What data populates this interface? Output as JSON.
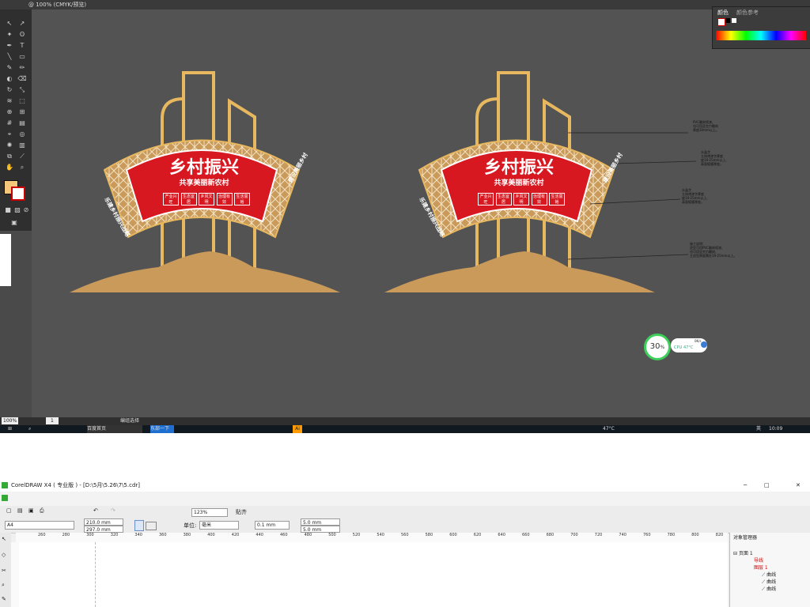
{
  "illustrator": {
    "tab_title": "@ 100% (CMYK/预览)",
    "color_panel": {
      "tab_color": "颜色",
      "tab_color_ref": "颜色参考"
    },
    "zoom": "100%",
    "page": "1",
    "status": "编组选择",
    "signs": {
      "title": "乡村振兴",
      "subtitle": "共享美丽新农村",
      "badges": [
        "产业兴旺",
        "生态宜居",
        "乡风文明",
        "治理有效",
        "生活富裕"
      ],
      "left_band": "乐建乡村振兴战略",
      "right_band": "建设美丽乡村"
    },
    "annotations": [
      "PVC雕刻喷漆,\n也可用亚克力雕刻\n厚度30mm以上。",
      "水晶字\n立体烤漆字厚度\n度19-25mm以上,\n表面镀膜厚度。",
      "水晶字\n立体烤漆字厚度\n度19-25mm以上,\n表面镀膜厚度。",
      "施工说明:\n造型可用PVC雕刻喷漆,\n也可用亚克力雕刻,\n主造型厚度需在19-25mm以上。"
    ],
    "cpu_widget": {
      "percent": "30",
      "percent_unit": "%",
      "label": "CPU",
      "temp": "47°C",
      "speed": "0K/s"
    },
    "taskbar": {
      "weather": "47°C",
      "lang": "英",
      "time": "10:09",
      "start_label": "东部一下",
      "task1": "百度首页"
    }
  },
  "coreldraw": {
    "title": "CorelDRAW X4 ( 专业版 ) - [D:\\5月\\5.26\\7\\5.cdr]",
    "zoom": "123%",
    "snap_label": "贴齐",
    "page_size": "A4",
    "width": "210.0 mm",
    "height": "297.0 mm",
    "unit_label": "单位:",
    "unit": "毫米",
    "nudge": "0.1 mm",
    "dup_x": "5.0 mm",
    "dup_y": "5.0 mm",
    "ruler_ticks": [
      "260",
      "280",
      "300",
      "320",
      "340",
      "360",
      "380",
      "400",
      "420",
      "440",
      "460",
      "480",
      "500",
      "520",
      "540",
      "560",
      "580",
      "600",
      "620",
      "640",
      "660",
      "680",
      "700",
      "720",
      "740",
      "760",
      "780",
      "800",
      "820",
      "840",
      "860",
      "880"
    ],
    "object_manager": {
      "title": "对象管理器",
      "page": "页面 1",
      "layer_guides": "导线",
      "layer1": "图层 1",
      "items": [
        "曲线",
        "曲线",
        "曲线"
      ]
    }
  },
  "colors": {
    "gold": "#e7b85f",
    "brown": "#c99a5a",
    "red": "#d81820",
    "canvas": "#535353"
  }
}
